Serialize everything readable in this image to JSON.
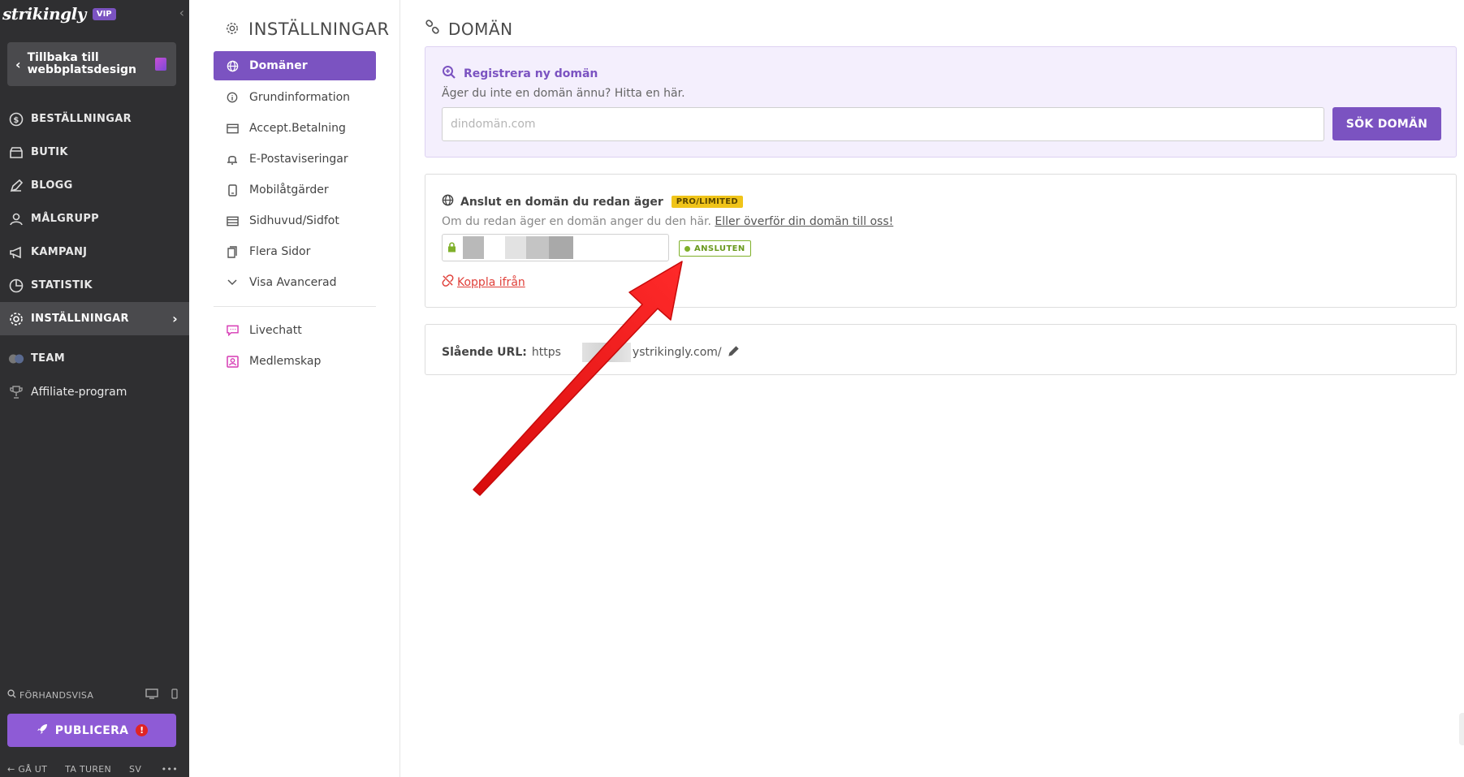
{
  "sidebar": {
    "brand": "strikingly",
    "vip": "VIP",
    "back_label": "Tillbaka till webbplatsdesign",
    "items": [
      {
        "label": "BESTÄLLNINGAR"
      },
      {
        "label": "BUTIK"
      },
      {
        "label": "BLOGG"
      },
      {
        "label": "MÅLGRUPP"
      },
      {
        "label": "KAMPANJ"
      },
      {
        "label": "STATISTIK"
      },
      {
        "label": "INSTÄLLNINGAR"
      },
      {
        "label": "TEAM"
      },
      {
        "label": "Affiliate-program"
      }
    ],
    "preview": "FÖRHANDSVISA",
    "publish": "PUBLICERA",
    "publish_warn": "!",
    "exit": "GÅ UT",
    "tour": "TA TUREN",
    "lang": "SV",
    "more": "•••"
  },
  "settings": {
    "title": "INSTÄLLNINGAR",
    "items": [
      {
        "label": "Domäner"
      },
      {
        "label": "Grundinformation"
      },
      {
        "label": "Accept.Betalning"
      },
      {
        "label": "E-Postaviseringar"
      },
      {
        "label": "Mobilåtgärder"
      },
      {
        "label": "Sidhuvud/Sidfot"
      },
      {
        "label": "Flera Sidor"
      },
      {
        "label": "Visa Avancerad"
      },
      {
        "label": "Livechatt"
      },
      {
        "label": "Medlemskap"
      }
    ]
  },
  "main": {
    "title": "DOMÄN",
    "register": {
      "title": "Registrera ny domän",
      "subtitle": "Äger du inte en domän ännu? Hitta en här.",
      "placeholder": "dindomän.com",
      "button": "SÖK DOMÄN"
    },
    "connect": {
      "title": "Anslut en domän du redan äger",
      "badge": "PRO/LIMITED",
      "subtitle": "Om du redan äger en domän anger du den här.",
      "transfer_link": "Eller överför din domän till oss!",
      "status": "ANSLUTEN",
      "disconnect": "Koppla ifrån"
    },
    "slug": {
      "label": "Slående URL:",
      "prefix": "https",
      "suffix": "ystrikingly.com/"
    }
  },
  "colors": {
    "accent": "#7b53c1",
    "sidebar_bg": "#2f2f31",
    "success": "#7fb02a",
    "danger": "#e0403a",
    "badge": "#f0c419",
    "annotation_arrow": "#ee1111"
  }
}
